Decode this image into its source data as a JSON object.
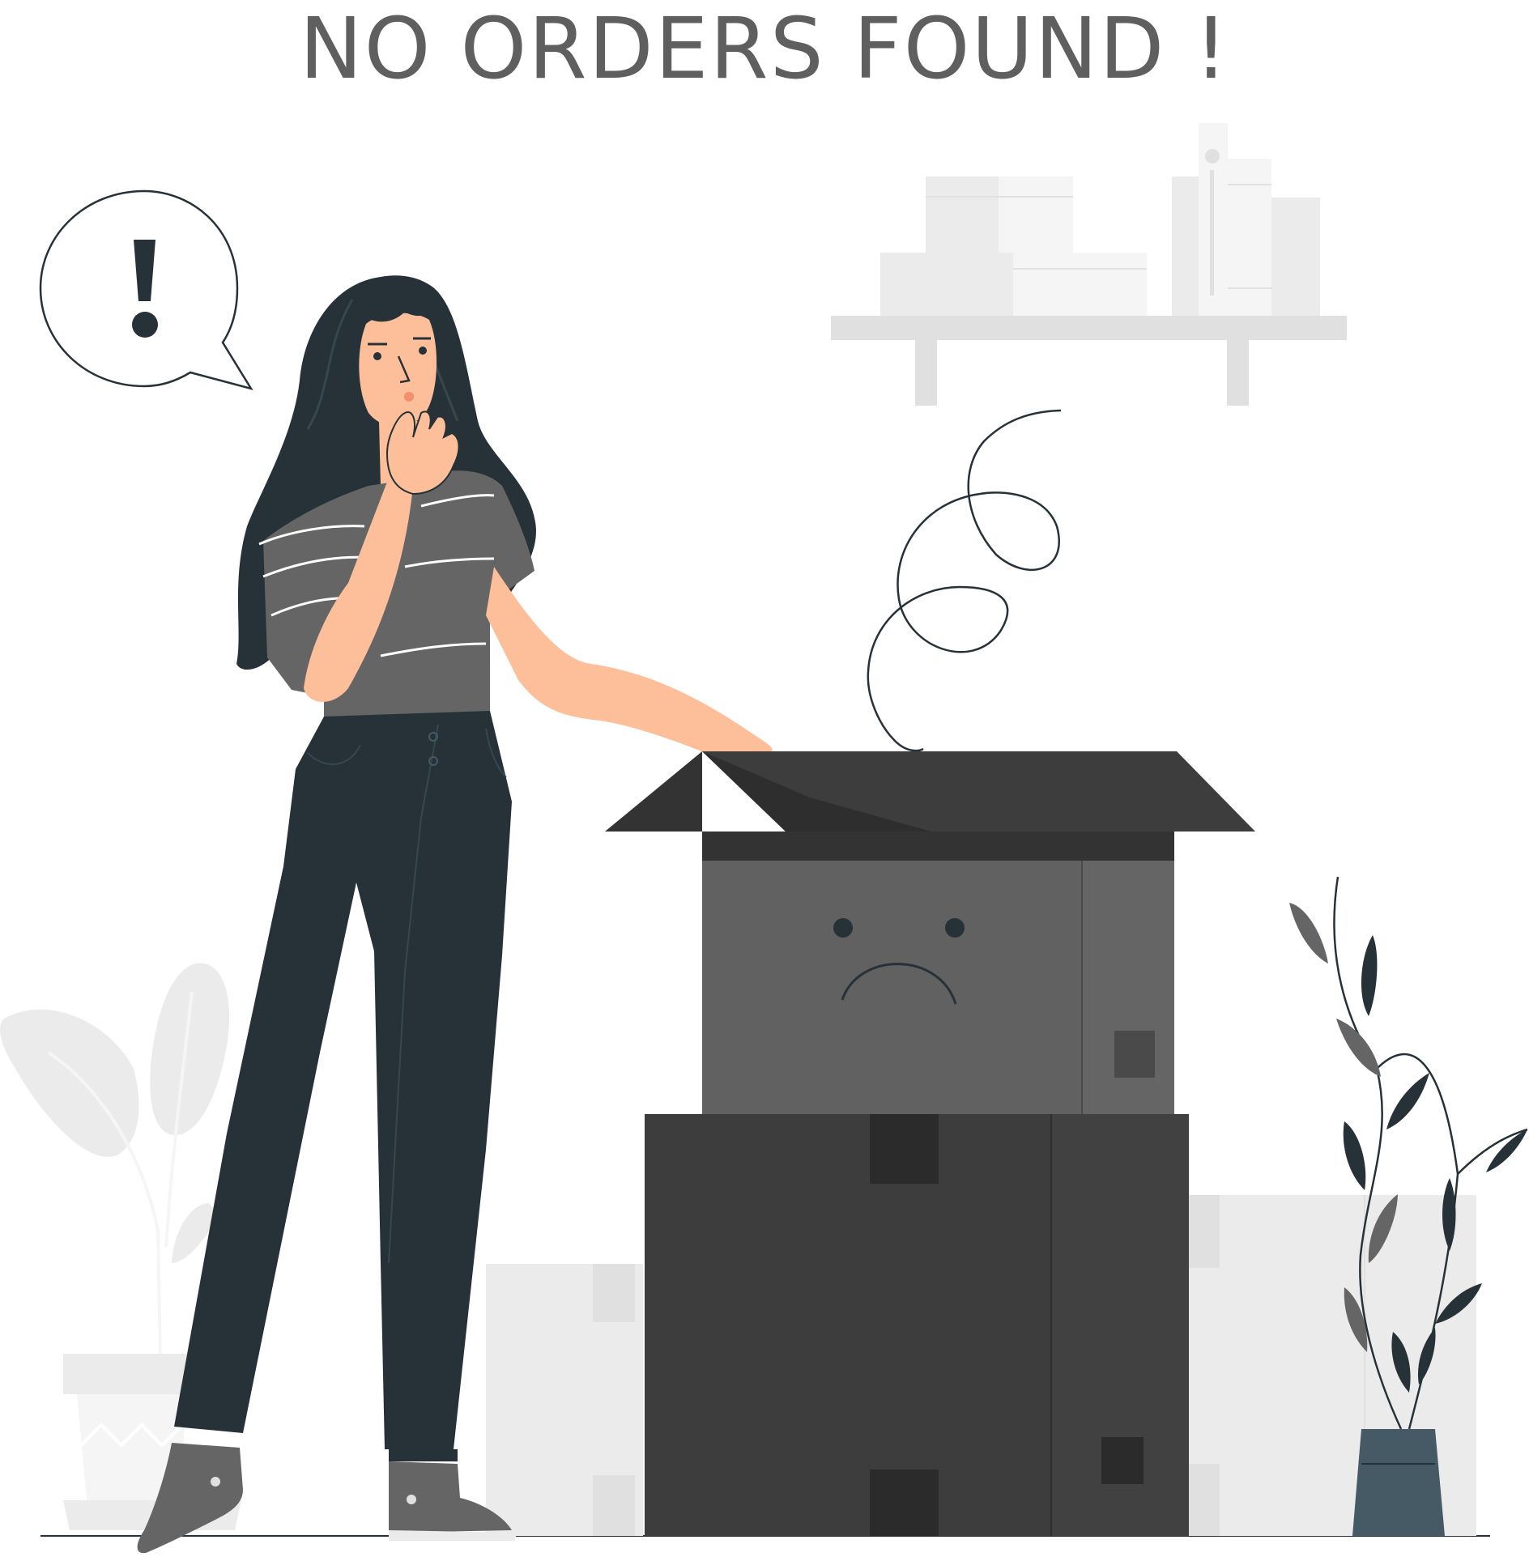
{
  "heading": {
    "text": "NO ORDERS FOUND !"
  },
  "illustration": {
    "speech_bubble_symbol": "!",
    "icons": [
      "exclamation-icon",
      "sad-face-icon"
    ],
    "colors": {
      "heading": "#5f5f5f",
      "hair": "#263238",
      "skin": "#fdbf9a",
      "shirt": "#656565",
      "pants": "#263238",
      "box_top": "#616161",
      "box_bottom": "#3d3d3e",
      "shelf": "#e0e0e0",
      "background_objects": "#ebebeb",
      "pot": "#455a64"
    }
  }
}
